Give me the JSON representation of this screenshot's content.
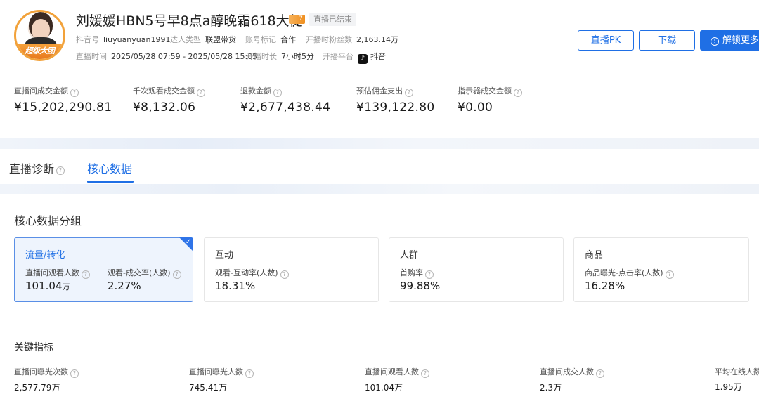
{
  "header": {
    "avatar_band_text": "超级大团",
    "title": "刘媛媛HBN5号早8点a醇晚霜618大促",
    "level_badge": "7",
    "status_badge": "直播已结束",
    "douyin_id_label": "抖音号",
    "douyin_id": "liuyuanyuan1991",
    "creator_type_label": "达人类型",
    "creator_type": "联盟带货",
    "account_tag_label": "账号标记",
    "account_tag": "合作",
    "start_fans_label": "开播时粉丝数",
    "start_fans": "2,163.14万",
    "live_time_label": "直播时间",
    "live_time": "2025/05/28 07:59 - 2025/05/28 15:05",
    "duration_label": "开播时长",
    "duration": "7小时5分",
    "platform_label": "开播平台",
    "platform": "抖音",
    "platform_icon": "douyin-icon"
  },
  "actions": {
    "pk": "直播PK",
    "download": "下载",
    "unlock": "解锁更多"
  },
  "top_metrics": [
    {
      "label": "直播间成交金额",
      "value": "¥15,202,290.81"
    },
    {
      "label": "千次观看成交金额",
      "value": "¥8,132.06"
    },
    {
      "label": "退款金额",
      "value": "¥2,677,438.44"
    },
    {
      "label": "预估佣金支出",
      "value": "¥139,122.80"
    },
    {
      "label": "指示器成交金额",
      "value": "¥0.00"
    }
  ],
  "tabs": {
    "diagnosis": "直播诊断",
    "core": "核心数据"
  },
  "core_group": {
    "title": "核心数据分组",
    "cards": [
      {
        "name": "流量/转化",
        "metrics": [
          {
            "label": "直播间观看人数",
            "value": "101.04",
            "unit": "万"
          },
          {
            "label": "观看-成交率(人数)",
            "value": "2.27%",
            "unit": ""
          }
        ]
      },
      {
        "name": "互动",
        "metrics": [
          {
            "label": "观看-互动率(人数)",
            "value": "18.31%",
            "unit": ""
          }
        ]
      },
      {
        "name": "人群",
        "metrics": [
          {
            "label": "首购率",
            "value": "99.88%",
            "unit": ""
          }
        ]
      },
      {
        "name": "商品",
        "metrics": [
          {
            "label": "商品曝光-点击率(人数)",
            "value": "16.28%",
            "unit": ""
          }
        ]
      }
    ]
  },
  "key_metrics": {
    "title": "关键指标",
    "items": [
      {
        "label": "直播间曝光次数",
        "value": "2,577.79万"
      },
      {
        "label": "直播间曝光人数",
        "value": "745.41万"
      },
      {
        "label": "直播间观看人数",
        "value": "101.04万"
      },
      {
        "label": "直播间成交人数",
        "value": "2.3万"
      },
      {
        "label": "平均在线人数",
        "value": "1.95万"
      }
    ]
  },
  "colors": {
    "accent": "#1f6fe5",
    "active_card_bg": "#eef4fd",
    "badge_orange": "#f08f1f"
  }
}
